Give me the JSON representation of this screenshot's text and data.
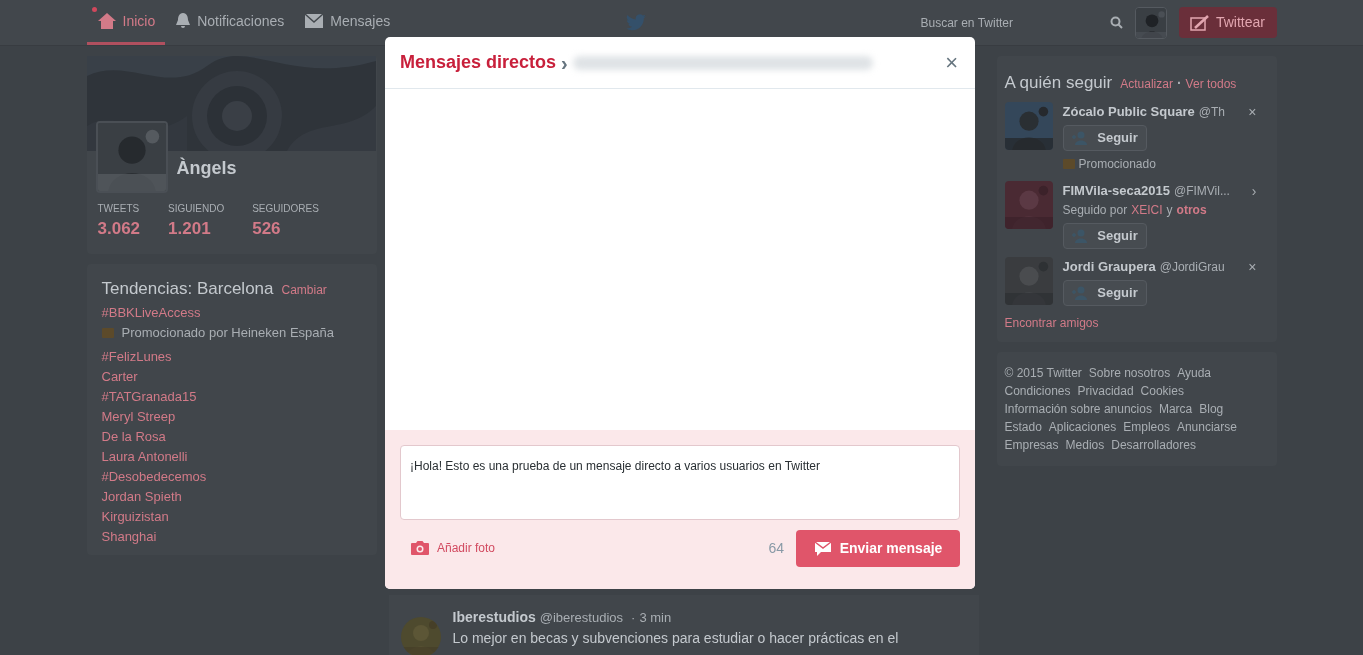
{
  "nav": {
    "items": [
      {
        "label": "Inicio",
        "selected": true,
        "dot": true
      },
      {
        "label": "Notificaciones",
        "selected": false,
        "dot": false
      },
      {
        "label": "Mensajes",
        "selected": false,
        "dot": false
      }
    ],
    "search": {
      "placeholder": "Buscar en Twitter"
    },
    "tweet_button": "Twittear"
  },
  "profile": {
    "name": "Àngels",
    "stats": [
      {
        "label": "TWEETS",
        "value": "3.062"
      },
      {
        "label": "SIGUIENDO",
        "value": "1.201"
      },
      {
        "label": "SEGUIDORES",
        "value": "526"
      }
    ]
  },
  "trends": {
    "title": "Tendencias: Barcelona",
    "change": "Cambiar",
    "items": [
      {
        "kind": "promoted",
        "label": "#BBKLiveAccess",
        "promo": "Promocionado por Heineken España"
      },
      {
        "kind": "plain",
        "label": "#FelizLunes"
      },
      {
        "kind": "plain",
        "label": "Carter"
      },
      {
        "kind": "plain",
        "label": "#TATGranada15"
      },
      {
        "kind": "plain",
        "label": "Meryl Streep"
      },
      {
        "kind": "plain",
        "label": "De la Rosa"
      },
      {
        "kind": "plain",
        "label": "Laura Antonelli"
      },
      {
        "kind": "plain",
        "label": "#Desobedecemos"
      },
      {
        "kind": "plain",
        "label": "Jordan Spieth"
      },
      {
        "kind": "plain",
        "label": "Kirguizistan"
      },
      {
        "kind": "plain",
        "label": "Shanghai"
      }
    ]
  },
  "who_to_follow": {
    "title": "A quién seguir",
    "refresh": "Actualizar",
    "separator": "·",
    "view_all": "Ver todos",
    "users": [
      {
        "name": "Zócalo Public Square",
        "handle": "@Th",
        "follow": "Seguir",
        "dismiss": "×",
        "context": {
          "kind": "promoted",
          "text": "Promocionado"
        }
      },
      {
        "name": "FIMVila-seca2015",
        "handle": "@FIMVil...",
        "follow": "Seguir",
        "dismiss": "›",
        "context": {
          "kind": "followed",
          "text": "Seguido por",
          "first": "XEICI",
          "joiner": "y",
          "second": "otros"
        }
      },
      {
        "name": "Jordi Graupera",
        "handle": "@JordiGrau",
        "follow": "Seguir",
        "dismiss": "×"
      }
    ],
    "find_friends": "Encontrar amigos"
  },
  "footer": {
    "lines": [
      [
        "© 2015 Twitter",
        "Sobre nosotros",
        "Ayuda"
      ],
      [
        "Condiciones",
        "Privacidad",
        "Cookies"
      ],
      [
        "Información sobre anuncios",
        "Marca",
        "Blog"
      ],
      [
        "Estado",
        "Aplicaciones",
        "Empleos",
        "Anunciarse"
      ],
      [
        "Empresas",
        "Medios",
        "Desarrolladores"
      ]
    ]
  },
  "tweet": {
    "name": "Iberestudios",
    "handle": "@iberestudios",
    "time_separator": "·",
    "time": "3 min",
    "text": "Lo mejor en becas y subvenciones para estudiar o hacer prácticas en el"
  },
  "modal": {
    "title": "Mensajes directos",
    "chevron": "›",
    "close": "×",
    "message": "¡Hola! Esto es una prueba de un mensaje directo a varios usuarios en Twitter",
    "add_photo": "Añadir foto",
    "counter": "64",
    "send": "Enviar mensaje"
  }
}
